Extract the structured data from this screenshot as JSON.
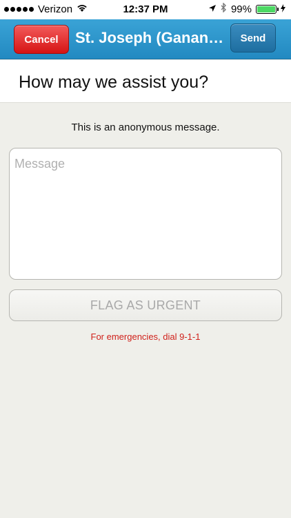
{
  "status_bar": {
    "carrier": "Verizon",
    "time": "12:37 PM",
    "battery": "99%",
    "battery_level": 0.99,
    "icons": [
      "signal-dots-icon",
      "wifi-icon",
      "location-arrow-icon",
      "bluetooth-icon",
      "battery-icon",
      "charging-bolt-icon"
    ]
  },
  "nav": {
    "cancel_label": "Cancel",
    "title": "St. Joseph (Gananoque)",
    "send_label": "Send",
    "colors": {
      "bar": "#2a94c9",
      "cancel": "#e02020",
      "send": "#2b7db0"
    }
  },
  "heading": "How may we assist you?",
  "anon_note": "This is an anonymous message.",
  "message": {
    "placeholder": "Message",
    "value": ""
  },
  "flag_label": "FLAG AS URGENT",
  "emergency_note": "For emergencies, dial 9-1-1",
  "accent_colors": {
    "emergency_text": "#d0211b"
  }
}
